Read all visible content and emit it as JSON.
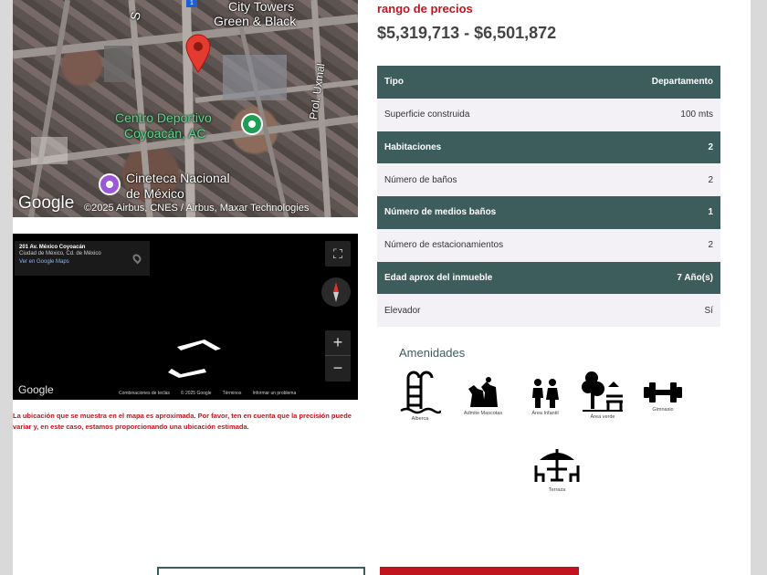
{
  "map": {
    "labels": {
      "city_towers": "City Towers",
      "green_black": "Green & Black",
      "centro_1": "Centro Deportivo",
      "centro_2": "Coyoacán, AC",
      "cineteca_1": "Cineteca Nacional",
      "cineteca_2": "de México",
      "street_prol": "Prol. Uxmal",
      "street_s": "S"
    },
    "logo": "Google",
    "attribution": "©2025 Airbus, CNES / Airbus, Maxar Technologies",
    "road_marker": "1"
  },
  "street_view": {
    "address": "201 Av. México Coyoacán",
    "city": "Ciudad de México, Cd. de México",
    "link": "Ver en Google Maps",
    "logo": "Google",
    "zoom_in": "+",
    "zoom_out": "−",
    "footer_links": [
      "Combinaciones de teclas",
      "© 2025 Google",
      "Términos",
      "Informar un problema"
    ]
  },
  "disclaimer": "La ubicación que se muestra en el mapa es aproximada. Por favor, ten en cuenta que la precisión puede variar y, en este caso, estamos proporcionando una ubicación estimada.",
  "price": {
    "label": "rango de precios",
    "range": "$5,319,713 - $6,501,872"
  },
  "specs": [
    {
      "label": "Tipo",
      "value": "Departamento"
    },
    {
      "label": "Superficie construida",
      "value": "100 mts"
    },
    {
      "label": "Habitaciones",
      "value": "2"
    },
    {
      "label": "Número de baños",
      "value": "2"
    },
    {
      "label": "Número de medios baños",
      "value": "1"
    },
    {
      "label": "Número de estacionamientos",
      "value": "2"
    },
    {
      "label": "Edad aprox del inmueble",
      "value": "7 Año(s)"
    },
    {
      "label": "Elevador",
      "value": "Sí"
    }
  ],
  "amenities": {
    "title": "Amenidades",
    "items": [
      {
        "name": "Alberca",
        "icon": "pool-icon"
      },
      {
        "name": "Admite Mascotas",
        "icon": "pets-icon"
      },
      {
        "name": "Área Infantil",
        "icon": "kids-icon"
      },
      {
        "name": "Área verde",
        "icon": "green-area-icon"
      },
      {
        "name": "Gimnasio",
        "icon": "gym-icon"
      },
      {
        "name": "Terraza",
        "icon": "terrace-icon"
      }
    ]
  },
  "colors": {
    "accent_red": "#c0141e",
    "table_dark": "#3d5c5c",
    "table_light": "#f4f1f6"
  }
}
